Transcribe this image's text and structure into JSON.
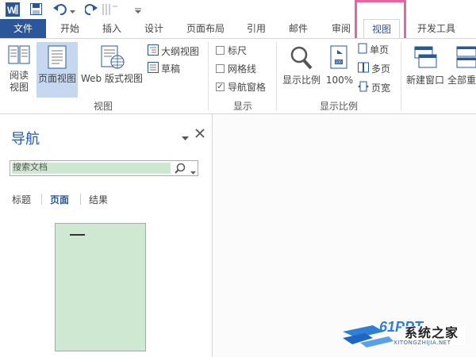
{
  "tabs": {
    "file": "文件",
    "home": "开始",
    "insert": "插入",
    "design": "设计",
    "layout": "页面布局",
    "references": "引用",
    "mailings": "邮件",
    "review": "审阅",
    "view": "视图",
    "developer": "开发工具"
  },
  "ribbon": {
    "read_mode": "阅读\n视图",
    "read_mode_1": "阅读",
    "read_mode_2": "视图",
    "print_layout": "页面视图",
    "web_layout": "Web 版式视图",
    "outline": "大纲视图",
    "draft": "草稿",
    "group_views": "视图",
    "ruler": "标尺",
    "gridlines": "网格线",
    "nav_pane": "导航窗格",
    "group_show": "显示",
    "zoom": "显示比例",
    "zoom100": "100%",
    "one_page": "单页",
    "multi_page": "多页",
    "page_width": "页宽",
    "group_zoom": "显示比例",
    "new_window": "新建窗口",
    "arrange_all": "全部重"
  },
  "checks": {
    "ruler": false,
    "gridlines": false,
    "nav_pane": true
  },
  "nav": {
    "title": "导航",
    "search_placeholder": "搜索文档",
    "tab_headings": "标题",
    "tab_pages": "页面",
    "tab_results": "结果"
  },
  "watermark": {
    "brand": "系统之家",
    "domain": "XITONGZHIJIA.NET"
  },
  "colors": {
    "file_tab": "#2b579a",
    "highlight": "#e8659b",
    "thumb": "#cfe8d2"
  }
}
